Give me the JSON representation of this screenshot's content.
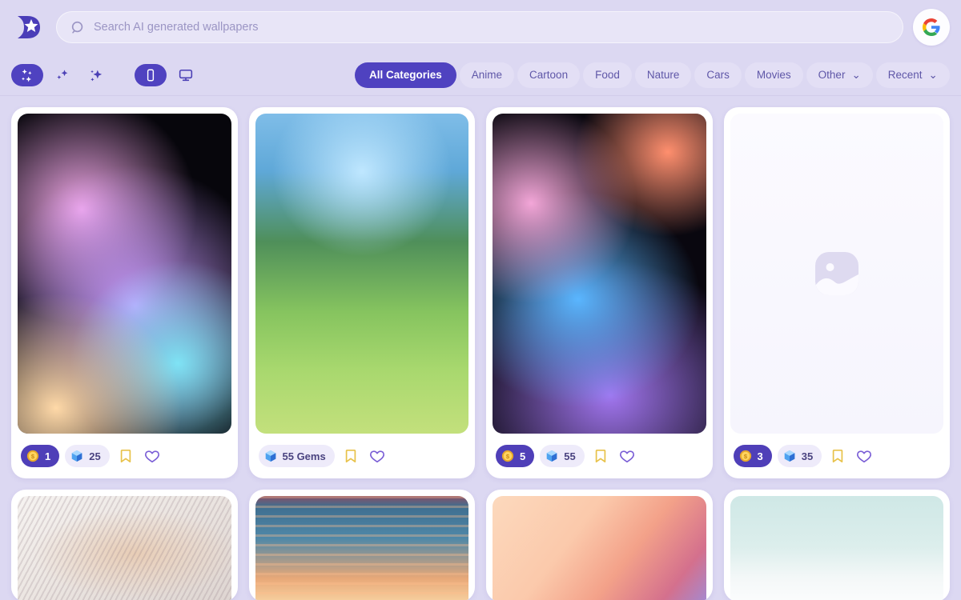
{
  "app": {
    "logo_icon": "wallpaper-d-star-logo",
    "background_color": "#dcd8f2",
    "accent_color": "#4f42c0"
  },
  "search": {
    "icon": "search-icon",
    "placeholder": "Search AI generated wallpapers",
    "value": ""
  },
  "account": {
    "provider_icon": "google-g-icon"
  },
  "toolbar": {
    "style_tools": [
      {
        "name": "sparkles-filled-icon",
        "active": true
      },
      {
        "name": "sparkles-small-icon",
        "active": false
      },
      {
        "name": "sparkle-star-icon",
        "active": false
      }
    ],
    "device_tools": [
      {
        "name": "mobile-icon",
        "active": true
      },
      {
        "name": "desktop-icon",
        "active": false
      }
    ]
  },
  "categories": [
    {
      "label": "All Categories",
      "active": true,
      "dropdown": false
    },
    {
      "label": "Anime",
      "active": false,
      "dropdown": false
    },
    {
      "label": "Cartoon",
      "active": false,
      "dropdown": false
    },
    {
      "label": "Food",
      "active": false,
      "dropdown": false
    },
    {
      "label": "Nature",
      "active": false,
      "dropdown": false
    },
    {
      "label": "Cars",
      "active": false,
      "dropdown": false
    },
    {
      "label": "Movies",
      "active": false,
      "dropdown": false
    },
    {
      "label": "Other",
      "active": false,
      "dropdown": true
    },
    {
      "label": "Recent",
      "active": false,
      "dropdown": true
    }
  ],
  "chevron_glyph": "⌄",
  "wallpapers": {
    "row1": [
      {
        "art": "art-holo1",
        "alt": "holographic-iridescent-ribbon",
        "placeholder": false,
        "coin": {
          "show": true,
          "value": "1"
        },
        "gem": {
          "show": true,
          "value": "25"
        },
        "bookmark_icon": "bookmark-icon",
        "like_icon": "heart-icon"
      },
      {
        "art": "art-forest",
        "alt": "anime-forest-path",
        "placeholder": false,
        "coin": {
          "show": false,
          "value": ""
        },
        "gem": {
          "show": true,
          "value": "55 Gems"
        },
        "bookmark_icon": "bookmark-icon",
        "like_icon": "heart-icon"
      },
      {
        "art": "art-holo2",
        "alt": "holographic-purple-wave",
        "placeholder": false,
        "coin": {
          "show": true,
          "value": "5"
        },
        "gem": {
          "show": true,
          "value": "55"
        },
        "bookmark_icon": "bookmark-icon",
        "like_icon": "heart-icon"
      },
      {
        "art": "art-placeholder",
        "alt": "image-placeholder",
        "placeholder": true,
        "coin": {
          "show": true,
          "value": "3"
        },
        "gem": {
          "show": true,
          "value": "35"
        },
        "bookmark_icon": "bookmark-icon",
        "like_icon": "heart-icon"
      }
    ],
    "row2": [
      {
        "art": "art-waves",
        "alt": "white-flowing-3d-waves"
      },
      {
        "art": "art-sunset",
        "alt": "sunset-palm-tree-beach-house"
      },
      {
        "art": "art-peach",
        "alt": "peach-gradient-abstract"
      },
      {
        "art": "art-sky",
        "alt": "pale-sky-clouds-birds"
      }
    ]
  }
}
